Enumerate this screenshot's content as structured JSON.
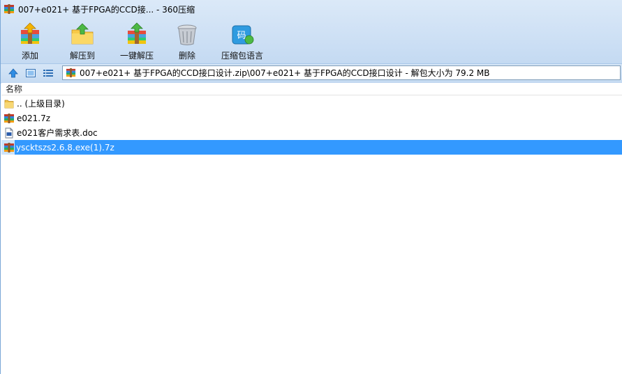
{
  "window": {
    "title": "007+e021+ 基于FPGA的CCD接... - 360压缩"
  },
  "toolbar": {
    "buttons": [
      {
        "label": "添加",
        "icon": "add-archive-icon"
      },
      {
        "label": "解压到",
        "icon": "extract-to-icon"
      },
      {
        "label": "一键解压",
        "icon": "one-click-extract-icon"
      },
      {
        "label": "删除",
        "icon": "trash-icon"
      },
      {
        "label": "压缩包语言",
        "icon": "archive-language-icon",
        "icon_text": "码"
      }
    ]
  },
  "address": {
    "path": "007+e021+ 基于FPGA的CCD接口设计.zip\\007+e021+ 基于FPGA的CCD接口设计 - 解包大小为 79.2 MB"
  },
  "list": {
    "column_name": "名称",
    "items": [
      {
        "name": ".. (上级目录)",
        "type": "folder"
      },
      {
        "name": "e021.7z",
        "type": "archive"
      },
      {
        "name": "e021客户需求表.doc",
        "type": "doc"
      },
      {
        "name": "yscktszs2.6.8.exe(1).7z",
        "type": "archive",
        "selected": true
      }
    ]
  },
  "colors": {
    "selection": "#3399ff",
    "chrome": "#cfe1f5"
  }
}
